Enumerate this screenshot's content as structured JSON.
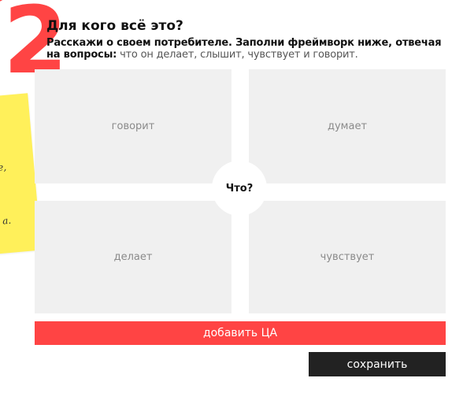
{
  "header": {
    "step_number": "2",
    "title": "Для кого всё это?",
    "subtitle_bold": "Расскажи о своем потребителе. Заполни фреймворк ниже, отвечая на вопросы:",
    "subtitle_light": "что он делает, слышит, чувствует и говорит."
  },
  "framework": {
    "center_label": "Что?",
    "quadrants": {
      "says": "говорит",
      "thinks": "думает",
      "does": "делает",
      "feels": "чувствует"
    }
  },
  "actions": {
    "add_label": "добавить ЦА",
    "save_label": "сохранить"
  },
  "sticky_note": {
    "mark_1": "е,",
    "mark_2": "а."
  },
  "colors": {
    "accent": "#ff4444",
    "sticky": "#fff05a",
    "dark": "#222222",
    "quadrant_bg": "#f0f0f0"
  }
}
